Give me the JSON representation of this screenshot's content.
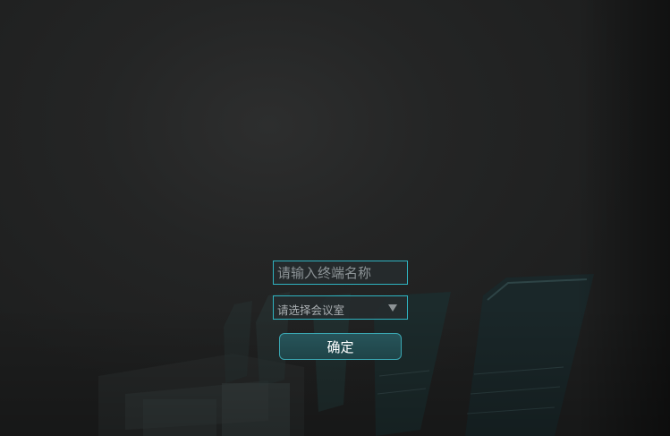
{
  "login_form": {
    "terminal_name": {
      "placeholder": "请输入终端名称",
      "value": ""
    },
    "meeting_room": {
      "selected_label": "请选择会议室",
      "icon": "chevron-down-icon"
    },
    "confirm_label": "确定"
  },
  "colors": {
    "background": "#1f2121",
    "accent_border": "#2fb3c0",
    "button_fill": "#245055",
    "text_light": "#ffffff"
  }
}
